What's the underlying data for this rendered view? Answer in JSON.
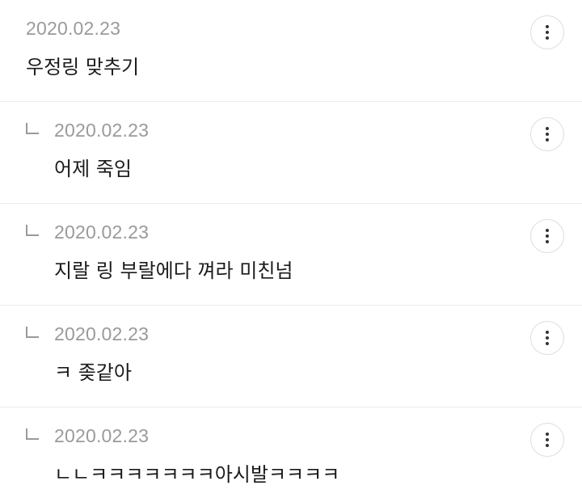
{
  "comments": [
    {
      "date": "2020.02.23",
      "text": "우정링 맞추기",
      "reply": false,
      "menu_icon": "more-vertical-icon"
    },
    {
      "date": "2020.02.23",
      "text": "어제 죽임",
      "reply": true,
      "menu_icon": "more-vertical-icon"
    },
    {
      "date": "2020.02.23",
      "text": "지랄 링 부랄에다 껴라 미친넘",
      "reply": true,
      "menu_icon": "more-vertical-icon"
    },
    {
      "date": "2020.02.23",
      "text": "ㅋ 좆같아",
      "reply": true,
      "menu_icon": "more-vertical-icon"
    },
    {
      "date": "2020.02.23",
      "text": "ㄴㄴㅋㅋㅋㅋㅋㅋㅋ아시발ㅋㅋㅋㅋ",
      "reply": true,
      "menu_icon": "more-vertical-icon"
    }
  ],
  "colors": {
    "date": "#9a9a9a",
    "text": "#1b1b1b",
    "divider": "#ececec",
    "reply_mark": "#9a9a9a"
  }
}
